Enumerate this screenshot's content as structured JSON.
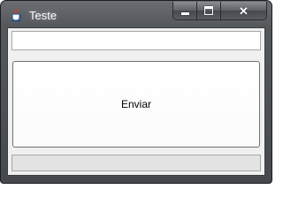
{
  "window": {
    "title": "Teste",
    "app_icon": "java-cup-icon",
    "controls": {
      "minimize": "minimize-icon",
      "maximize": "maximize-icon",
      "close": "close-icon",
      "close_glyph": "✕"
    }
  },
  "form": {
    "input_value": "",
    "button_label": "Enviar",
    "status_value": ""
  },
  "colors": {
    "frame": "#55595d",
    "client_background": "#f0f0f0",
    "close_button": "#5a5e62"
  }
}
